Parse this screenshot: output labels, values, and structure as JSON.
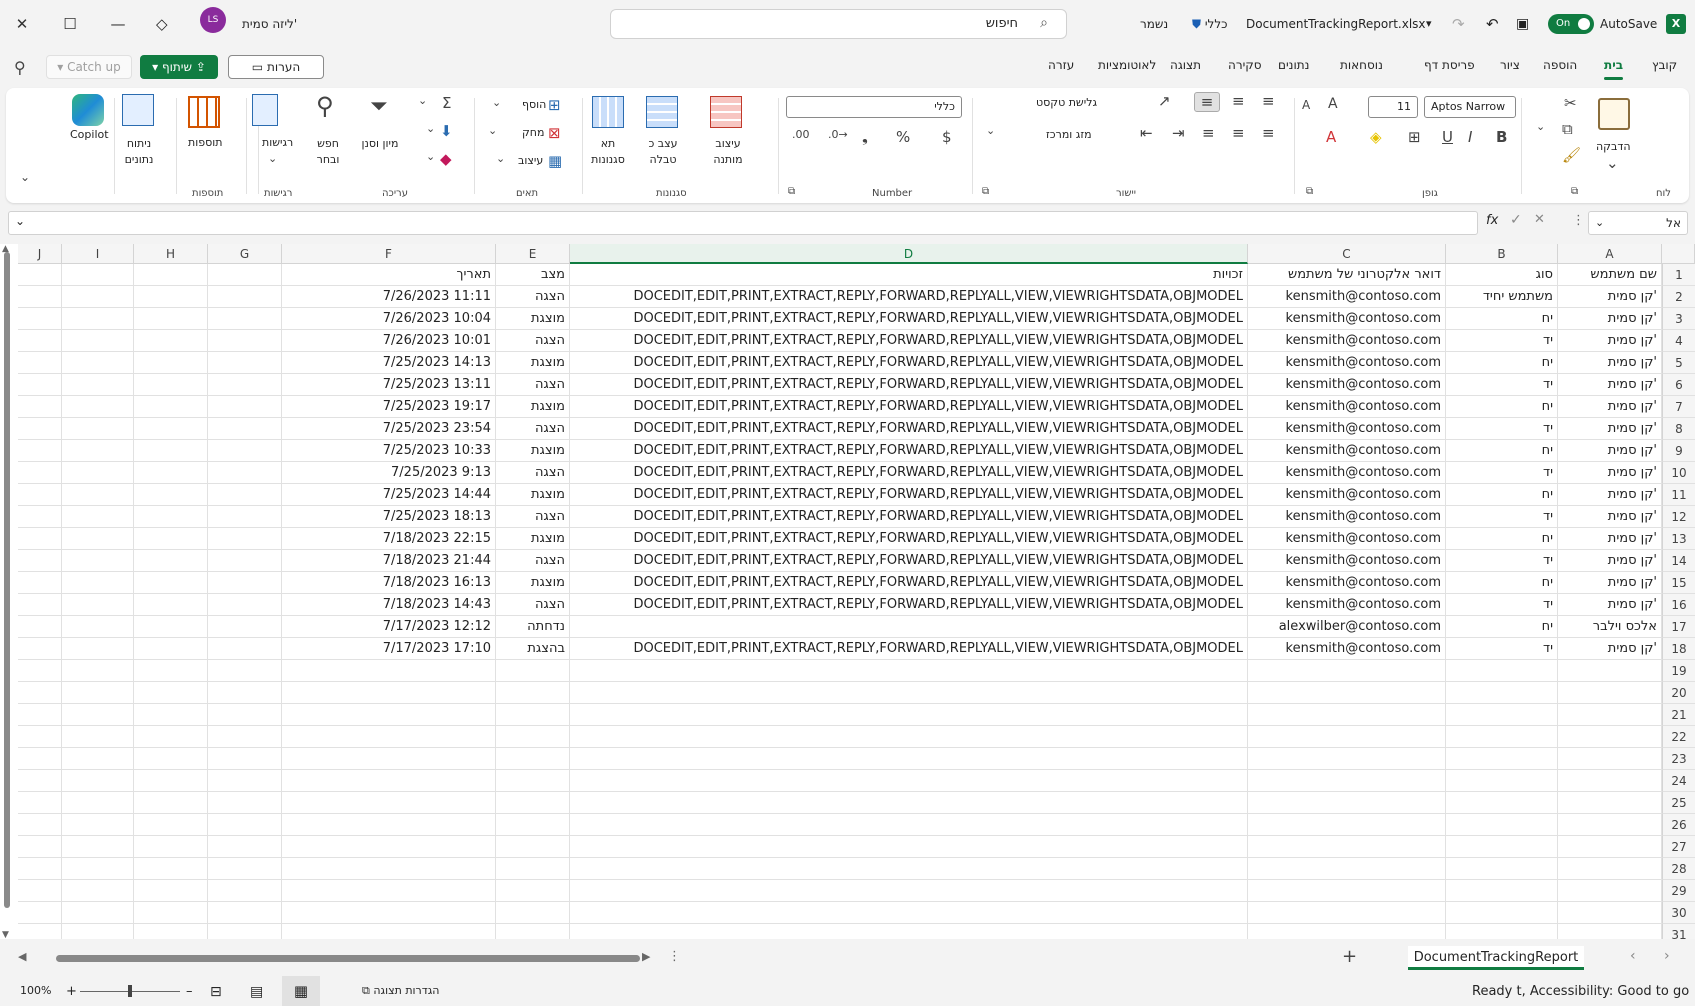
{
  "titlebar": {
    "app_icon": "X",
    "autosave_label": "AutoSave",
    "autosave_state": "On",
    "filename": "DocumentTrackingReport.xlsx",
    "sensitivity": "כללי",
    "saved_status": "נשמר",
    "search_label": "חיפוש",
    "user_name": "ליזה סמית'",
    "user_initials": "LS"
  },
  "menu": {
    "tabs": [
      "קובץ",
      "בית",
      "הוספה",
      "ציור",
      "פריסת דף",
      "נוסחאות",
      "נתונים",
      "סקירה",
      "תצוגה",
      "לאוטומציות",
      "עזרה"
    ],
    "share_label": "שיתוף",
    "comments_label": "הערות",
    "catchup_label": "Catch up"
  },
  "ribbon": {
    "clipboard": {
      "label": "לוח",
      "paste": "הדבקה"
    },
    "font": {
      "label": "גופן",
      "font_name": "Aptos Narrow",
      "font_size": "11"
    },
    "alignment": {
      "label": "יישור",
      "wrap_text": "גלישת טקסט",
      "merge": "מזג ומרכז"
    },
    "number": {
      "label": "Number",
      "format": "כללי"
    },
    "styles": {
      "label": "סגנונות",
      "conditional": "עיצוב מותנה",
      "format_table": "עצב כ טבלה",
      "cell_styles": "תא סגנונות"
    },
    "cells": {
      "label": "תאים",
      "insert": "הוסף",
      "delete": "מחק",
      "format": "עיצוב"
    },
    "editing": {
      "label": "עריכה",
      "sort_filter": "מיון וסנן",
      "find_select": "חפש ובחר"
    },
    "sensitivity_grp": {
      "label": "רגישות",
      "btn": "רגישות"
    },
    "addins": {
      "label": "תוספות",
      "btn": "תוספות"
    },
    "analyze": {
      "btn": "ניתוח נתונים"
    },
    "copilot": {
      "btn": "Copilot"
    }
  },
  "formula": {
    "name_box": "אל",
    "fx": "fx",
    "value": ""
  },
  "sheet": {
    "columns": [
      "A",
      "B",
      "C",
      "D",
      "E",
      "F",
      "G",
      "H",
      "I",
      "J"
    ],
    "row_numbers": [
      "1",
      "2",
      "3",
      "4",
      "5",
      "6",
      "7",
      "8",
      "9",
      "10",
      "11",
      "12",
      "13",
      "14",
      "15",
      "16",
      "17",
      "18",
      "19",
      "20",
      "21",
      "22",
      "23",
      "24",
      "25",
      "26",
      "27",
      "28",
      "29",
      "30",
      "31"
    ],
    "headers": [
      "שם משתמש",
      "סוג",
      "דואר אלקטרוני של משתמש",
      "זכויות",
      "מצב",
      "תאריך"
    ],
    "rows": [
      [
        "קן סמית'",
        "משתמש יחיד",
        "kensmith@contoso.com",
        "DOCEDIT,EDIT,PRINT,EXTRACT,REPLY,FORWARD,REPLYALL,VIEW,VIEWRIGHTSDATA,OBJMODEL",
        "הצגה",
        "7/26/2023 11:11"
      ],
      [
        "קן סמית'",
        "יח",
        "kensmith@contoso.com",
        "DOCEDIT,EDIT,PRINT,EXTRACT,REPLY,FORWARD,REPLYALL,VIEW,VIEWRIGHTSDATA,OBJMODEL",
        "מוצגת",
        "7/26/2023 10:04"
      ],
      [
        "קן סמית'",
        "יד",
        "kensmith@contoso.com",
        "DOCEDIT,EDIT,PRINT,EXTRACT,REPLY,FORWARD,REPLYALL,VIEW,VIEWRIGHTSDATA,OBJMODEL",
        "הצגה",
        "7/26/2023 10:01"
      ],
      [
        "קן סמית'",
        "יח",
        "kensmith@contoso.com",
        "DOCEDIT,EDIT,PRINT,EXTRACT,REPLY,FORWARD,REPLYALL,VIEW,VIEWRIGHTSDATA,OBJMODEL",
        "מוצגת",
        "7/25/2023 14:13"
      ],
      [
        "קן סמית'",
        "יד",
        "kensmith@contoso.com",
        "DOCEDIT,EDIT,PRINT,EXTRACT,REPLY,FORWARD,REPLYALL,VIEW,VIEWRIGHTSDATA,OBJMODEL",
        "הצגה",
        "7/25/2023 13:11"
      ],
      [
        "קן סמית'",
        "יח",
        "kensmith@contoso.com",
        "DOCEDIT,EDIT,PRINT,EXTRACT,REPLY,FORWARD,REPLYALL,VIEW,VIEWRIGHTSDATA,OBJMODEL",
        "מוצגת",
        "7/25/2023 19:17"
      ],
      [
        "קן סמית'",
        "יד",
        "kensmith@contoso.com",
        "DOCEDIT,EDIT,PRINT,EXTRACT,REPLY,FORWARD,REPLYALL,VIEW,VIEWRIGHTSDATA,OBJMODEL",
        "הצגה",
        "7/25/2023 23:54"
      ],
      [
        "קן סמית'",
        "יח",
        "kensmith@contoso.com",
        "DOCEDIT,EDIT,PRINT,EXTRACT,REPLY,FORWARD,REPLYALL,VIEW,VIEWRIGHTSDATA,OBJMODEL",
        "מוצגת",
        "7/25/2023 10:33"
      ],
      [
        "קן סמית'",
        "יד",
        "kensmith@contoso.com",
        "DOCEDIT,EDIT,PRINT,EXTRACT,REPLY,FORWARD,REPLYALL,VIEW,VIEWRIGHTSDATA,OBJMODEL",
        "הצגה",
        "7/25/2023 9:13"
      ],
      [
        "קן סמית'",
        "יח",
        "kensmith@contoso.com",
        "DOCEDIT,EDIT,PRINT,EXTRACT,REPLY,FORWARD,REPLYALL,VIEW,VIEWRIGHTSDATA,OBJMODEL",
        "מוצגת",
        "7/25/2023 14:44"
      ],
      [
        "קן סמית'",
        "יד",
        "kensmith@contoso.com",
        "DOCEDIT,EDIT,PRINT,EXTRACT,REPLY,FORWARD,REPLYALL,VIEW,VIEWRIGHTSDATA,OBJMODEL",
        "הצגה",
        "7/25/2023 18:13"
      ],
      [
        "קן סמית'",
        "יח",
        "kensmith@contoso.com",
        "DOCEDIT,EDIT,PRINT,EXTRACT,REPLY,FORWARD,REPLYALL,VIEW,VIEWRIGHTSDATA,OBJMODEL",
        "מוצגת",
        "7/18/2023 22:15"
      ],
      [
        "קן סמית'",
        "יד",
        "kensmith@contoso.com",
        "DOCEDIT,EDIT,PRINT,EXTRACT,REPLY,FORWARD,REPLYALL,VIEW,VIEWRIGHTSDATA,OBJMODEL",
        "הצגה",
        "7/18/2023 21:44"
      ],
      [
        "קן סמית'",
        "יח",
        "kensmith@contoso.com",
        "DOCEDIT,EDIT,PRINT,EXTRACT,REPLY,FORWARD,REPLYALL,VIEW,VIEWRIGHTSDATA,OBJMODEL",
        "מוצגת",
        "7/18/2023 16:13"
      ],
      [
        "קן סמית'",
        "יד",
        "kensmith@contoso.com",
        "DOCEDIT,EDIT,PRINT,EXTRACT,REPLY,FORWARD,REPLYALL,VIEW,VIEWRIGHTSDATA,OBJMODEL",
        "הצגה",
        "7/18/2023 14:43"
      ],
      [
        "אלכס וילבר",
        "יח",
        "alexwilber@contoso.com",
        "",
        "נדחתה",
        "7/17/2023 12:12"
      ],
      [
        "קן סמית'",
        "יד",
        "kensmith@contoso.com",
        "DOCEDIT,EDIT,PRINT,EXTRACT,REPLY,FORWARD,REPLYALL,VIEW,VIEWRIGHTSDATA,OBJMODEL",
        "בהצגת",
        "7/17/2023 17:10"
      ]
    ]
  },
  "sheetbar": {
    "sheet_name": "DocumentTrackingReport",
    "add_sheet": "+"
  },
  "status": {
    "ready_text": "Ready t, Accessibility: Good to go",
    "display_settings": "הגדרות תצוגה",
    "zoom": "100%"
  },
  "colors": {
    "accent": "#107c41",
    "avatar": "#8a2b9c"
  }
}
